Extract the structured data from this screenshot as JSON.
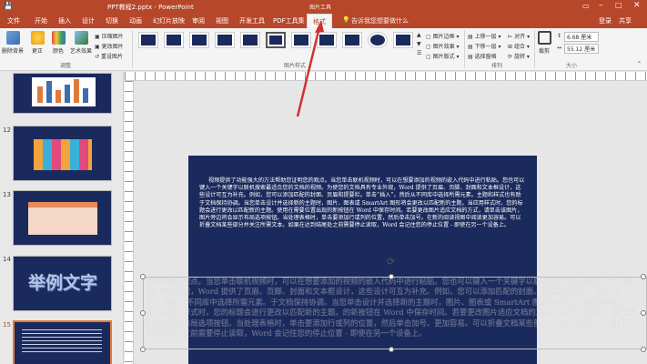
{
  "window": {
    "title": "PPT教程2.pptx - PowerPoint",
    "tool_context": "图片工具",
    "signin": "登录",
    "share": "共享"
  },
  "tabs": [
    "文件",
    "开始",
    "插入",
    "设计",
    "切换",
    "动画",
    "幻灯片放映",
    "审阅",
    "视图",
    "开发工具",
    "PDF工具集",
    "格式"
  ],
  "tell_me": "告诉我您想要做什么",
  "ribbon": {
    "adjust": {
      "remove_bg": "删除背景",
      "corrections": "更正",
      "color": "颜色",
      "artistic": "艺术效果",
      "compress": "压缩图片",
      "change": "更改图片",
      "reset": "重设图片",
      "label": "调整"
    },
    "styles": {
      "label": "图片样式",
      "border": "图片边框",
      "effects": "图片效果",
      "layout": "图片版式"
    },
    "arrange": {
      "label": "排列",
      "forward": "上移一层",
      "backward": "下移一层",
      "selection_pane": "选择窗格",
      "align": "对齐",
      "group": "组合",
      "rotate": "旋转"
    },
    "crop": {
      "label": "裁剪"
    },
    "size": {
      "label": "大小",
      "height": "6.68 厘米",
      "width": "55.12 厘米"
    }
  },
  "slides": [
    {
      "num": "12"
    },
    {
      "num": "13"
    },
    {
      "num": "14",
      "text": "举例文字"
    },
    {
      "num": "15"
    }
  ],
  "slide_body": "视频提供了功能强大的方法帮助您证明您的观点。当您单击联机视频时，可以在想要添加的视频的嵌入代码中进行粘贴。您也可以键入一个关键字以联机搜索最适合您的文档的视频。为使您的文档具有专业外观，Word 提供了页眉、页脚、封面和文本框设计，这些设计可互为补充。例如，您可以添加匹配的封面、页眉和提要栏。单击“插入”，然后从不同库中选择所需元素。主题和样式也有助于文档保持协调。当您单击设计并选择新的主题时，图片、图表或 SmartArt 图形将会更改以匹配新的主题。当应用样式时，您的标题会进行更改以匹配新的主题。使用在需要位置出现的新按钮在 Word 中保存时间。若要更改图片适应文档的方式，请单击该图片，图片旁边将会显示布局选项按钮。当处理表格时，单击要添加行或列的位置，然后单击加号。在新的阅读视图中阅读更加容易。可以折叠文档某些部分并关注所需文本。如果在达到结尾处之前需要停止读取，Word 会记住您的停止位置 - 即使在另一个设备上。",
  "selected_image_text": "您证明您的观点。当您单击联机视频时，可以在想要添加的视频的嵌入代码中进行粘贴。您也可以键入一个关键字以联机搜索最适合您的文档的视频。专业外观，Word 提供了页眉、页脚、封面和文本框设计，这些设计可互为补充。例如，您可以添加匹配的封面、页眉和提要栏。单击“插入”，然后从不同库中选择所需元素。于文档保持协调。当您单击设计并选择新的主题时，图片、图表或 SmartArt 图形将会更改以匹配新的主题。当应用样式时，您的标题会进行更改以匹配新的主题。的新按钮在 Word 中保存时间。若要更改图片适应文档的方式，请单击该图片，图片旁边将会显示布局选项按钮。当处理表格时，单击要添加行或列的位置，然后单击加号。更加容易。可以折叠文档某些部分并关注所需文本。如果在达到结尾处之前需要停止读取，Word 会记住您的停止位置 - 即使在另一个设备上。",
  "colors": {
    "accent": "#b7472a",
    "slide_bg": "#1b2a5c",
    "arrow": "#d0312d"
  }
}
